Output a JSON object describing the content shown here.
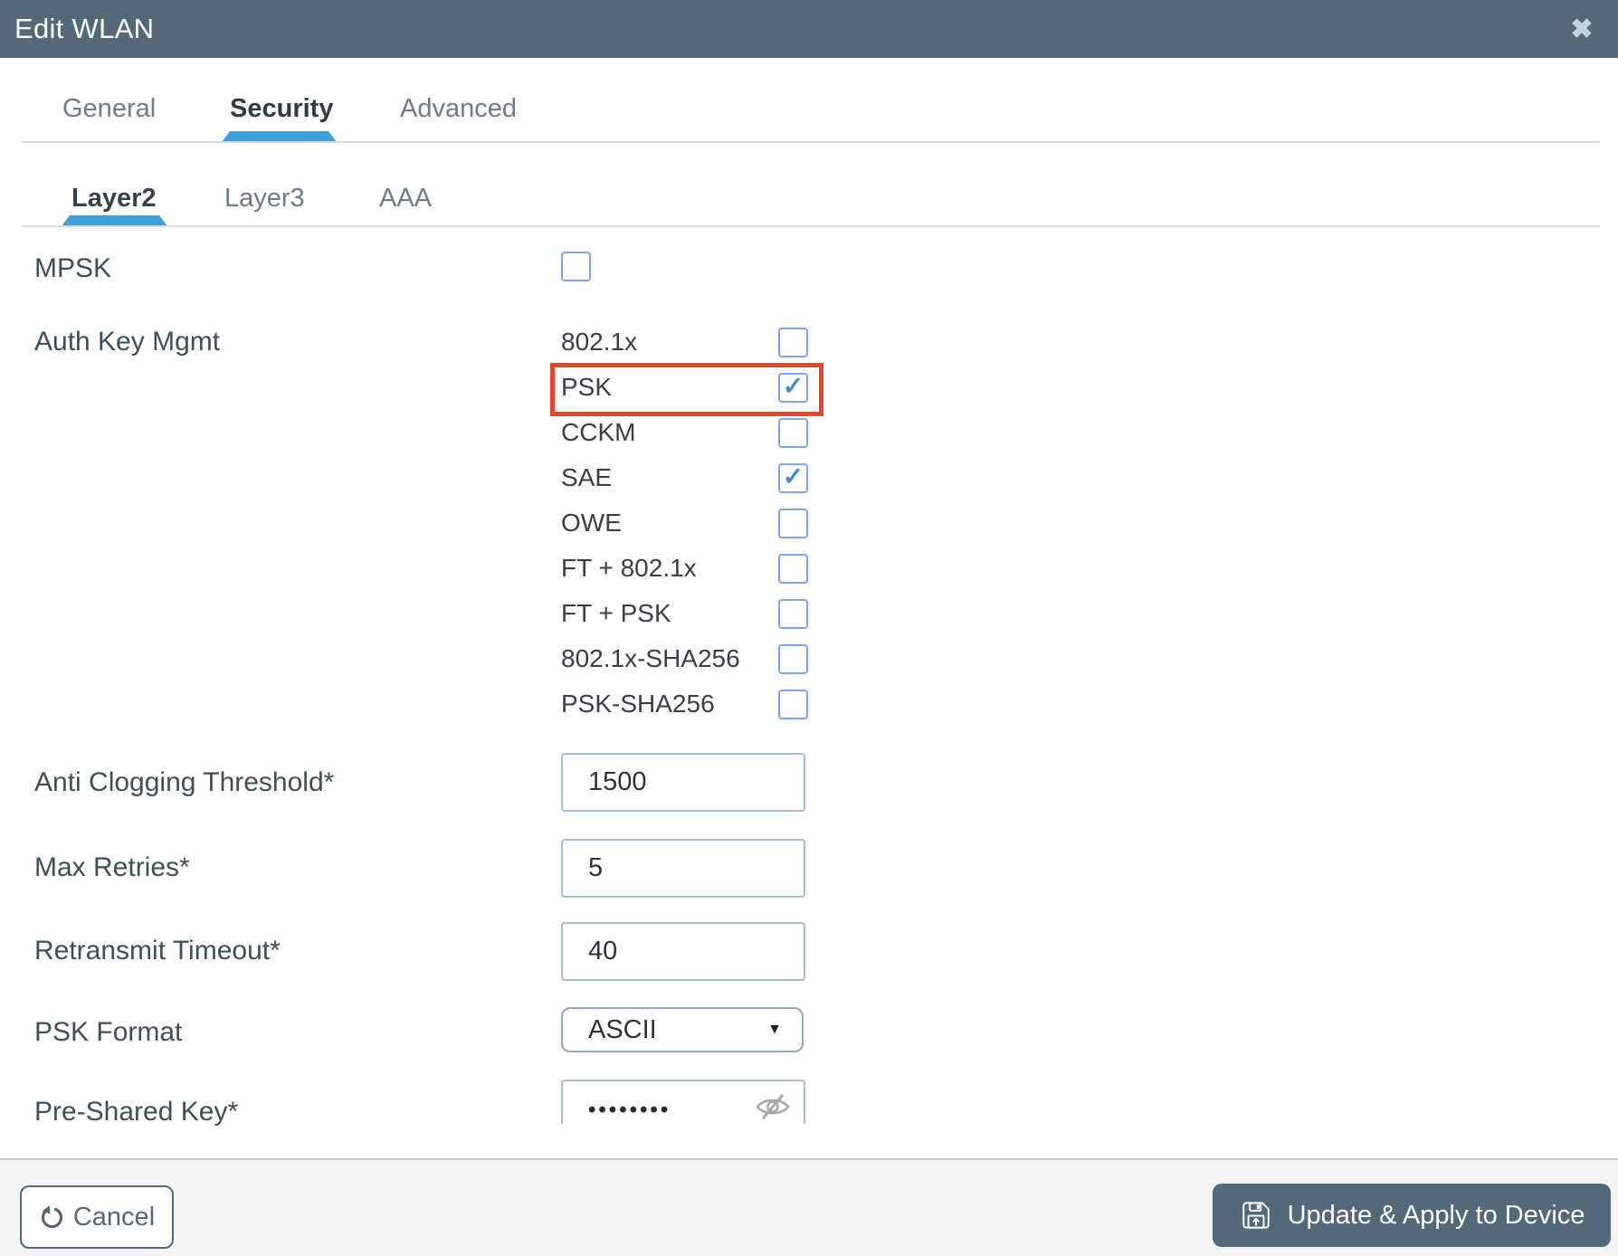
{
  "header": {
    "title": "Edit WLAN"
  },
  "icons": {
    "close": "✖",
    "caret": "▼"
  },
  "tabs": {
    "general": "General",
    "security": "Security",
    "advanced": "Advanced"
  },
  "subtabs": {
    "layer2": "Layer2",
    "layer3": "Layer3",
    "aaa": "AAA"
  },
  "form": {
    "mpsk": {
      "label": "MPSK",
      "checked": false,
      "check": ""
    },
    "auth_key_mgmt": {
      "label": "Auth Key Mgmt",
      "options": [
        {
          "label": "802.1x",
          "checked": false,
          "check": ""
        },
        {
          "label": "PSK",
          "checked": true,
          "check": "✓",
          "highlighted": true
        },
        {
          "label": "CCKM",
          "checked": false,
          "check": ""
        },
        {
          "label": "SAE",
          "checked": true,
          "check": "✓"
        },
        {
          "label": "OWE",
          "checked": false,
          "check": ""
        },
        {
          "label": "FT + 802.1x",
          "checked": false,
          "check": ""
        },
        {
          "label": "FT + PSK",
          "checked": false,
          "check": ""
        },
        {
          "label": "802.1x-SHA256",
          "checked": false,
          "check": ""
        },
        {
          "label": "PSK-SHA256",
          "checked": false,
          "check": ""
        }
      ]
    },
    "anti_clogging": {
      "label": "Anti Clogging Threshold*",
      "value": "1500"
    },
    "max_retries": {
      "label": "Max Retries*",
      "value": "5"
    },
    "retransmit_timeout": {
      "label": "Retransmit Timeout*",
      "value": "40"
    },
    "psk_format": {
      "label": "PSK Format",
      "value": "ASCII"
    },
    "pre_shared_key": {
      "label": "Pre-Shared Key*",
      "value": "••••••••"
    }
  },
  "footer": {
    "cancel_label": "Cancel",
    "apply_label": "Update & Apply to Device"
  },
  "colors": {
    "header_bg": "#546878",
    "accent_blue": "#3f9fd9",
    "highlight_red": "#e8432c",
    "checkbox_border": "#7da3f1",
    "check_mark": "#3e8fc9",
    "button_slate": "#546879"
  }
}
